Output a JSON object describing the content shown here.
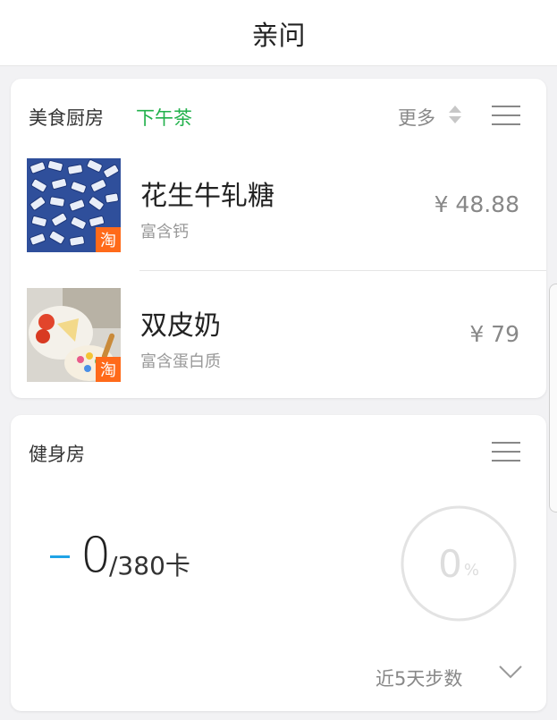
{
  "header": {
    "title": "亲问"
  },
  "food_section": {
    "title": "美食厨房",
    "tab": "下午茶",
    "more_label": "更多",
    "items": [
      {
        "name": "花生牛轧糖",
        "desc": "富含钙",
        "price": "¥ 48.88",
        "badge": "淘",
        "image": "blue-white-candies"
      },
      {
        "name": "双皮奶",
        "desc": "富含蛋白质",
        "price": "¥ 79",
        "badge": "淘",
        "image": "dessert-plate"
      }
    ]
  },
  "gym_section": {
    "title": "健身房",
    "current": "0",
    "goal": "/380卡",
    "percent": "0",
    "percent_unit": "%",
    "recent_label": "近5天步数"
  },
  "colors": {
    "accent_green": "#22b14c",
    "accent_blue": "#1fa3e6",
    "badge_orange": "#ff6a1a"
  }
}
